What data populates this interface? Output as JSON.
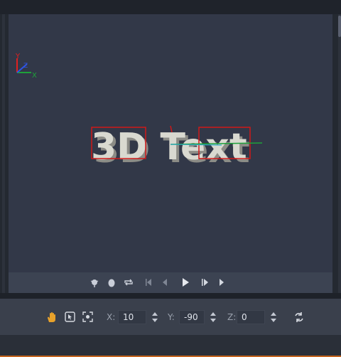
{
  "viewport": {
    "text": "3D Text",
    "axes": {
      "x_label": "X",
      "y_label": "Y",
      "z_label": "Z"
    }
  },
  "playback": {
    "buttons": [
      "pin-icon",
      "egg-icon",
      "loop-icon",
      "skip-start-icon",
      "step-back-icon",
      "play-icon",
      "step-forward-icon",
      "skip-end-icon"
    ]
  },
  "toolbar": {
    "x_label": "X:",
    "x_value": "10",
    "y_label": "Y:",
    "y_value": "-90",
    "z_label": "Z:",
    "z_value": "0"
  },
  "colors": {
    "viewport_bg": "#323848",
    "text_face": "#d9d9d0",
    "accent": "#c5651e",
    "axis_x": "#1ea13a",
    "axis_y": "#e02020",
    "axis_z": "#2f55e6"
  }
}
